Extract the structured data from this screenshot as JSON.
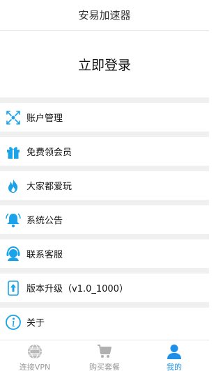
{
  "header": {
    "title": "安易加速器"
  },
  "login": {
    "label": "立即登录"
  },
  "menu": {
    "items": [
      {
        "label": "账户管理",
        "icon": "account-arrows-icon"
      },
      {
        "label": "免费领会员",
        "icon": "gift-icon"
      },
      {
        "label": "大家都爱玩",
        "icon": "fire-icon"
      },
      {
        "label": "系统公告",
        "icon": "bell-icon"
      },
      {
        "label": "联系客服",
        "icon": "headset-icon"
      },
      {
        "label": "版本升级（v1.0_1000）",
        "icon": "upgrade-icon"
      },
      {
        "label": "关于",
        "icon": "info-icon"
      }
    ]
  },
  "tabbar": {
    "tabs": [
      {
        "label": "连接VPN",
        "icon": "globe-icon",
        "active": false
      },
      {
        "label": "购买套餐",
        "icon": "cart-icon",
        "active": false
      },
      {
        "label": "我的",
        "icon": "user-icon",
        "active": true
      }
    ]
  },
  "colors": {
    "accent": "#1e90e8",
    "icon_blue": "#1aa3e8",
    "inactive": "#999999"
  }
}
